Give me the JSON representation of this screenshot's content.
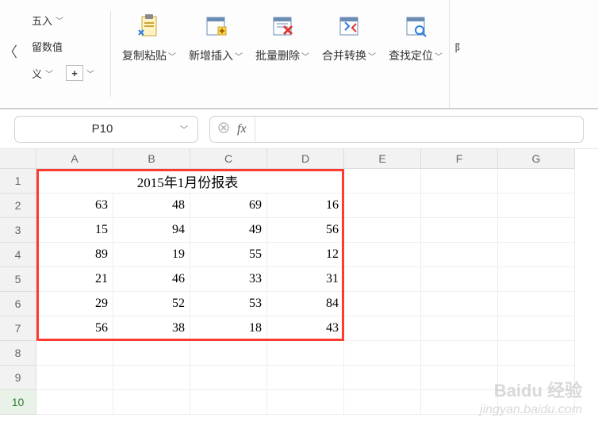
{
  "toolbar": {
    "left": {
      "item1": "五入",
      "item2": "留数值",
      "item3": "义",
      "more_symbol": "+"
    },
    "groups": [
      {
        "label": "复制粘贴",
        "icon": "clipboard-icon"
      },
      {
        "label": "新增插入",
        "icon": "insert-icon"
      },
      {
        "label": "批量删除",
        "icon": "delete-icon"
      },
      {
        "label": "合并转换",
        "icon": "merge-icon"
      },
      {
        "label": "查找定位",
        "icon": "find-icon"
      }
    ],
    "right_edge": "阝"
  },
  "namebox": {
    "value": "P10"
  },
  "formula": {
    "fx": "fx",
    "value": ""
  },
  "columns": [
    "A",
    "B",
    "C",
    "D",
    "E",
    "F",
    "G"
  ],
  "rows": [
    "1",
    "2",
    "3",
    "4",
    "5",
    "6",
    "7",
    "8",
    "9",
    "10"
  ],
  "active_row": "10",
  "sheet": {
    "title": "2015年1月份报表",
    "data": [
      [
        "63",
        "48",
        "69",
        "16"
      ],
      [
        "15",
        "94",
        "49",
        "56"
      ],
      [
        "89",
        "19",
        "55",
        "12"
      ],
      [
        "21",
        "46",
        "33",
        "31"
      ],
      [
        "29",
        "52",
        "53",
        "84"
      ],
      [
        "56",
        "38",
        "18",
        "43"
      ]
    ]
  },
  "watermark": {
    "top": "Baidu 经验",
    "bottom": "jingyan.baidu.com"
  },
  "chart_data": {
    "type": "table",
    "title": "2015年1月份报表",
    "columns": [
      "A",
      "B",
      "C",
      "D"
    ],
    "rows": [
      [
        63,
        48,
        69,
        16
      ],
      [
        15,
        94,
        49,
        56
      ],
      [
        89,
        19,
        55,
        12
      ],
      [
        21,
        46,
        33,
        31
      ],
      [
        29,
        52,
        53,
        84
      ],
      [
        56,
        38,
        18,
        43
      ]
    ]
  }
}
